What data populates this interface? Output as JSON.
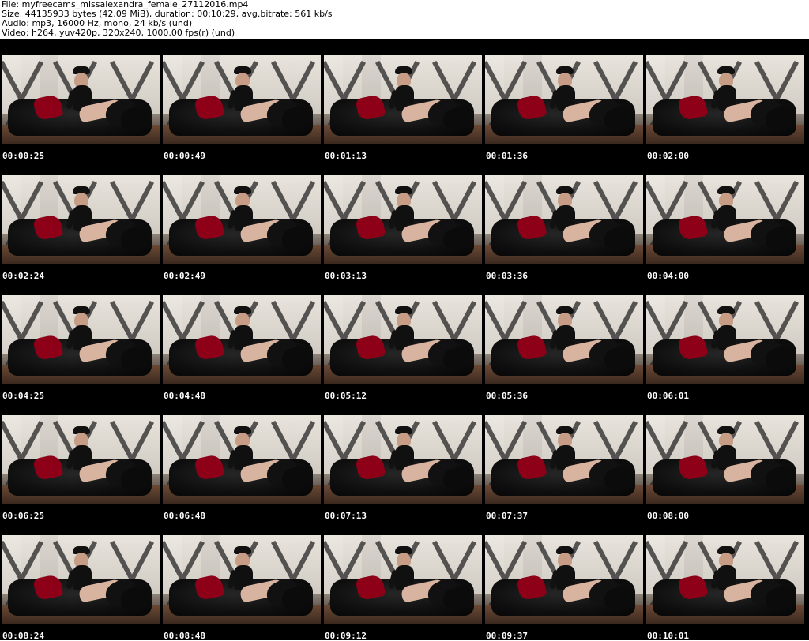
{
  "header": {
    "file_line": "File: myfreecams_missalexandra_female_27112016.mp4",
    "size_line": "Size: 44135933 bytes (42.09 MiB), duration: 00:10:29, avg.bitrate: 561 kb/s",
    "audio_line": "Audio: mp3, 16000 Hz, mono, 24 kb/s (und)",
    "video_line": "Video: h264, yuv420p, 320x240, 1000.00 fps(r) (und)"
  },
  "frames": [
    {
      "time": "00:00:25"
    },
    {
      "time": "00:00:49"
    },
    {
      "time": "00:01:13"
    },
    {
      "time": "00:01:36"
    },
    {
      "time": "00:02:00"
    },
    {
      "time": "00:02:24"
    },
    {
      "time": "00:02:49"
    },
    {
      "time": "00:03:13"
    },
    {
      "time": "00:03:36"
    },
    {
      "time": "00:04:00"
    },
    {
      "time": "00:04:25"
    },
    {
      "time": "00:04:48"
    },
    {
      "time": "00:05:12"
    },
    {
      "time": "00:05:36"
    },
    {
      "time": "00:06:01"
    },
    {
      "time": "00:06:25"
    },
    {
      "time": "00:06:48"
    },
    {
      "time": "00:07:13"
    },
    {
      "time": "00:07:37"
    },
    {
      "time": "00:08:00"
    },
    {
      "time": "00:08:24"
    },
    {
      "time": "00:08:48"
    },
    {
      "time": "00:09:12"
    },
    {
      "time": "00:09:37"
    },
    {
      "time": "00:10:01"
    }
  ]
}
